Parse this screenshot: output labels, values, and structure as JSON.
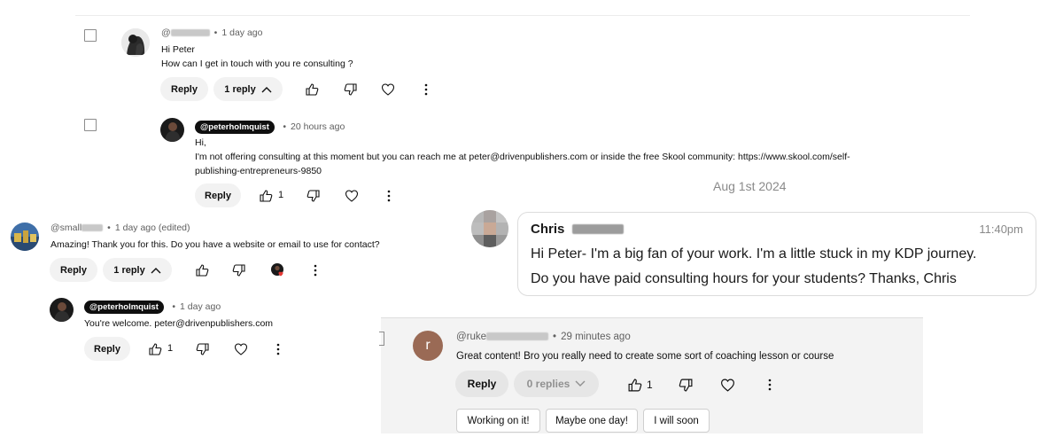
{
  "comment1": {
    "handle_prefix": "@",
    "time": "1 day ago",
    "greeting": "Hi Peter",
    "text": "How can I get in touch with you re consulting ?",
    "reply_label": "Reply",
    "replies_label": "1 reply"
  },
  "reply1": {
    "handle": "@peterholmquist",
    "time": "20 hours ago",
    "line1": "Hi,",
    "line2": "I'm not offering consulting at this moment but you can reach me at peter@drivenpublishers.com or inside the free Skool community: https://www.skool.com/self-",
    "line3": "publishing-entrepreneurs-9850",
    "reply_label": "Reply",
    "likes": "1"
  },
  "comment2": {
    "handle_prefix": "@small",
    "time": "1 day ago (edited)",
    "text": "Amazing! Thank you for this. Do you have a website or email to use for contact?",
    "reply_label": "Reply",
    "replies_label": "1 reply"
  },
  "reply2": {
    "handle": "@peterholmquist",
    "time": "1 day ago",
    "text": "You're welcome. peter@drivenpublishers.com",
    "reply_label": "Reply",
    "likes": "1"
  },
  "chat": {
    "date": "Aug 1st 2024",
    "sender_first": "Chris",
    "time": "11:40pm",
    "line1": "Hi Peter- I'm a big fan of your work. I'm a little stuck in my KDP journey.",
    "line2": "Do you have paid consulting hours for your students? Thanks, Chris"
  },
  "comment3": {
    "avatar_letter": "r",
    "handle_prefix": "@ruke",
    "time": "29 minutes ago",
    "text": "Great content! Bro you really need to create some sort of coaching lesson or course",
    "reply_label": "Reply",
    "replies_label": "0 replies",
    "likes": "1",
    "suggestions": [
      "Working on it!",
      "Maybe one day!",
      "I will soon"
    ]
  },
  "colors": {
    "reply_avatar_r": "#9a6a55",
    "pill_bg": "#f2f2f2",
    "heart_red": "#e53935"
  }
}
